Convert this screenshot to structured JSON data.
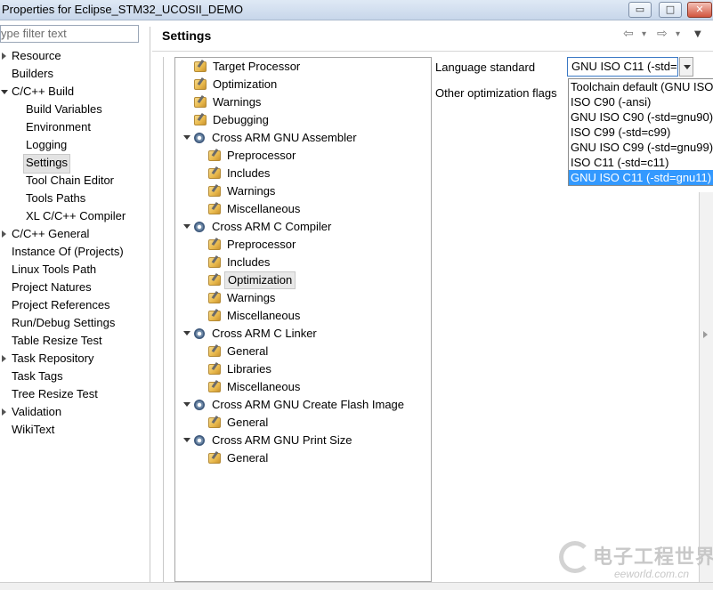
{
  "window": {
    "title": "Properties for Eclipse_STM32_UCOSII_DEMO",
    "buttons": {
      "minimize": "▭",
      "maximize": "□",
      "close": "✕"
    }
  },
  "filter": {
    "value": "ype filter text"
  },
  "left_nav": [
    {
      "label": "Resource",
      "indent": 0,
      "expander": "collapsed"
    },
    {
      "label": "Builders",
      "indent": 0,
      "expander": "none"
    },
    {
      "label": "C/C++ Build",
      "indent": 0,
      "expander": "expanded"
    },
    {
      "label": "Build Variables",
      "indent": 1,
      "expander": "none"
    },
    {
      "label": "Environment",
      "indent": 1,
      "expander": "none"
    },
    {
      "label": "Logging",
      "indent": 1,
      "expander": "none"
    },
    {
      "label": "Settings",
      "indent": 1,
      "expander": "none",
      "selected": true
    },
    {
      "label": "Tool Chain Editor",
      "indent": 1,
      "expander": "none"
    },
    {
      "label": "Tools Paths",
      "indent": 1,
      "expander": "none"
    },
    {
      "label": "XL C/C++ Compiler",
      "indent": 1,
      "expander": "none"
    },
    {
      "label": "C/C++ General",
      "indent": 0,
      "expander": "collapsed"
    },
    {
      "label": "Instance Of (Projects)",
      "indent": 0,
      "expander": "none"
    },
    {
      "label": "Linux Tools Path",
      "indent": 0,
      "expander": "none"
    },
    {
      "label": "Project Natures",
      "indent": 0,
      "expander": "none"
    },
    {
      "label": "Project References",
      "indent": 0,
      "expander": "none"
    },
    {
      "label": "Run/Debug Settings",
      "indent": 0,
      "expander": "none"
    },
    {
      "label": "Table Resize Test",
      "indent": 0,
      "expander": "none"
    },
    {
      "label": "Task Repository",
      "indent": 0,
      "expander": "collapsed"
    },
    {
      "label": "Task Tags",
      "indent": 0,
      "expander": "none"
    },
    {
      "label": "Tree Resize Test",
      "indent": 0,
      "expander": "none"
    },
    {
      "label": "Validation",
      "indent": 0,
      "expander": "collapsed"
    },
    {
      "label": "WikiText",
      "indent": 0,
      "expander": "none"
    }
  ],
  "settings": {
    "title": "Settings",
    "nav": {
      "back": "⇦",
      "back_menu": "▾",
      "forward": "⇨",
      "forward_menu": "▾",
      "view_menu": "▼"
    }
  },
  "tool_tree": [
    {
      "label": "Target Processor",
      "level": 0,
      "kind": "tool"
    },
    {
      "label": "Optimization",
      "level": 0,
      "kind": "tool"
    },
    {
      "label": "Warnings",
      "level": 0,
      "kind": "tool"
    },
    {
      "label": "Debugging",
      "level": 0,
      "kind": "tool"
    },
    {
      "label": "Cross ARM GNU Assembler",
      "level": 0,
      "kind": "gear"
    },
    {
      "label": "Preprocessor",
      "level": 1,
      "kind": "tool"
    },
    {
      "label": "Includes",
      "level": 1,
      "kind": "tool"
    },
    {
      "label": "Warnings",
      "level": 1,
      "kind": "tool"
    },
    {
      "label": "Miscellaneous",
      "level": 1,
      "kind": "tool"
    },
    {
      "label": "Cross ARM C Compiler",
      "level": 0,
      "kind": "gear"
    },
    {
      "label": "Preprocessor",
      "level": 1,
      "kind": "tool"
    },
    {
      "label": "Includes",
      "level": 1,
      "kind": "tool"
    },
    {
      "label": "Optimization",
      "level": 1,
      "kind": "tool",
      "selected": true
    },
    {
      "label": "Warnings",
      "level": 1,
      "kind": "tool"
    },
    {
      "label": "Miscellaneous",
      "level": 1,
      "kind": "tool"
    },
    {
      "label": "Cross ARM C Linker",
      "level": 0,
      "kind": "gear"
    },
    {
      "label": "General",
      "level": 1,
      "kind": "tool"
    },
    {
      "label": "Libraries",
      "level": 1,
      "kind": "tool"
    },
    {
      "label": "Miscellaneous",
      "level": 1,
      "kind": "tool"
    },
    {
      "label": "Cross ARM GNU Create Flash Image",
      "level": 0,
      "kind": "gear"
    },
    {
      "label": "General",
      "level": 1,
      "kind": "tool"
    },
    {
      "label": "Cross ARM GNU Print Size",
      "level": 0,
      "kind": "gear"
    },
    {
      "label": "General",
      "level": 1,
      "kind": "tool"
    }
  ],
  "options": {
    "language_standard_label": "Language standard",
    "language_standard_value": "GNU ISO C11 (-std=",
    "other_flags_label": "Other optimization flags",
    "dropdown_options": [
      "Toolchain default (GNU ISO",
      "ISO C90 (-ansi)",
      "GNU ISO C90 (-std=gnu90)",
      "ISO C99 (-std=c99)",
      "GNU ISO C99 (-std=gnu99)",
      "ISO C11 (-std=c11)",
      "GNU ISO C11 (-std=gnu11)"
    ],
    "dropdown_selected_index": 6
  },
  "watermark": {
    "cn": "电子工程世界",
    "en": "eeworld.com.cn"
  }
}
